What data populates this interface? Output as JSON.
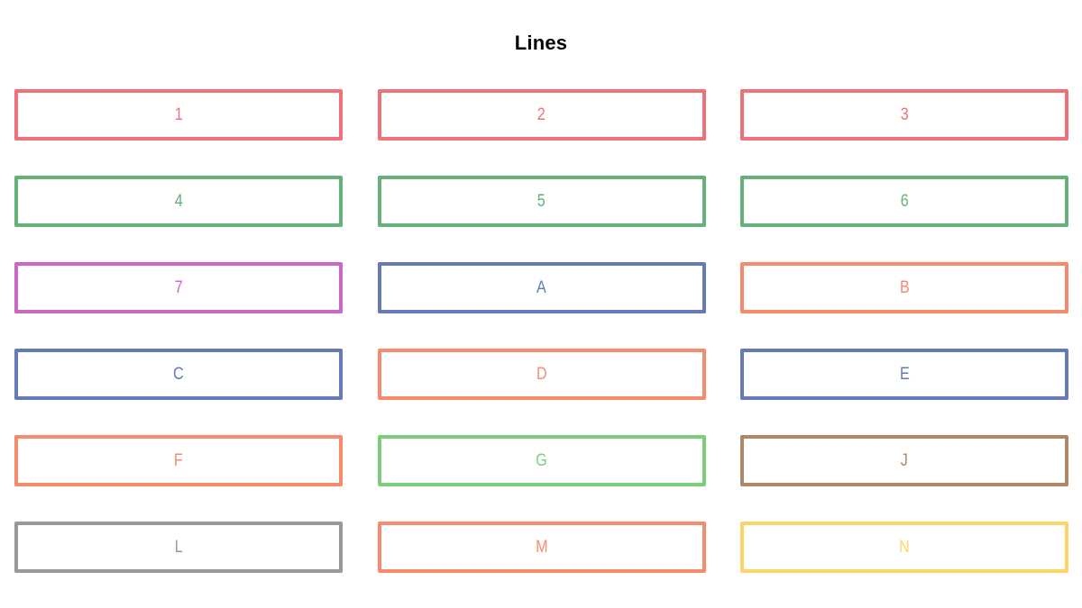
{
  "title": "Lines",
  "lines": [
    {
      "label": "1",
      "color": "#f0707a"
    },
    {
      "label": "2",
      "color": "#f0707a"
    },
    {
      "label": "3",
      "color": "#f0707a"
    },
    {
      "label": "4",
      "color": "#66b07a"
    },
    {
      "label": "5",
      "color": "#66b07a"
    },
    {
      "label": "6",
      "color": "#66b07a"
    },
    {
      "label": "7",
      "color": "#c966c6"
    },
    {
      "label": "A",
      "color": "#6679b8"
    },
    {
      "label": "B",
      "color": "#f78a6c"
    },
    {
      "label": "C",
      "color": "#6679b8"
    },
    {
      "label": "D",
      "color": "#f78a6c"
    },
    {
      "label": "E",
      "color": "#6679b8"
    },
    {
      "label": "F",
      "color": "#f78a6c"
    },
    {
      "label": "G",
      "color": "#7ccf7a"
    },
    {
      "label": "J",
      "color": "#b08666"
    },
    {
      "label": "L",
      "color": "#999999"
    },
    {
      "label": "M",
      "color": "#f78a6c"
    },
    {
      "label": "N",
      "color": "#fdd469"
    }
  ]
}
